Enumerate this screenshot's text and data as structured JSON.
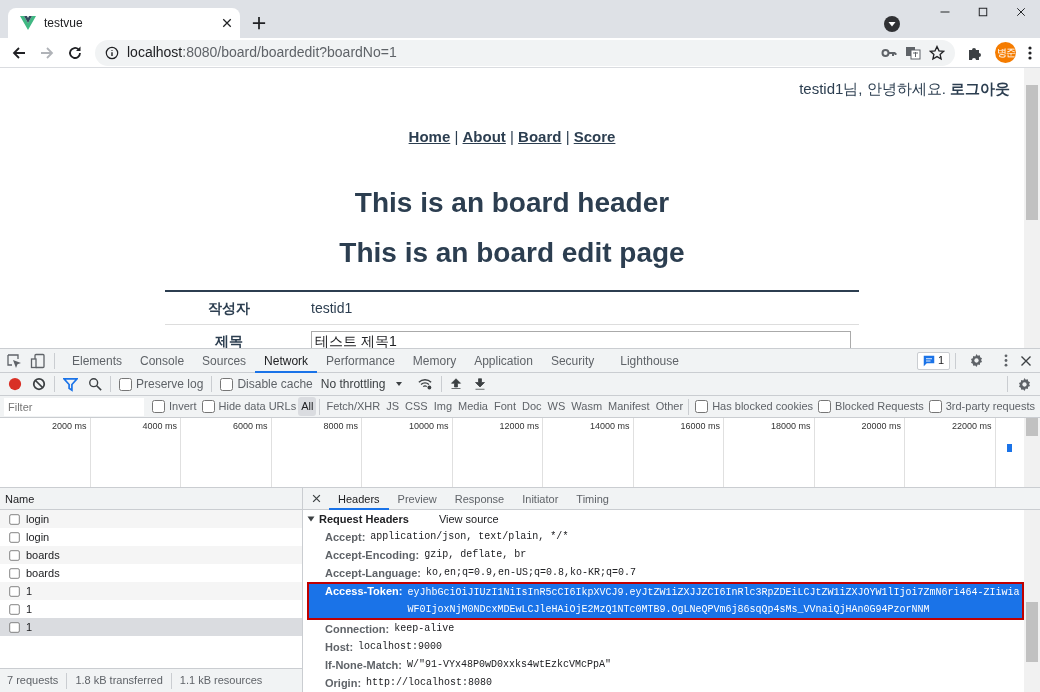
{
  "browser": {
    "tab_title": "testvue",
    "url": {
      "host": "localhost",
      "path": ":8080/board/boardedit?boardNo=1"
    },
    "avatar_text": "병준"
  },
  "page": {
    "greeting": "testid1님, 안녕하세요.",
    "logout": "로그아웃",
    "nav": [
      {
        "label": "Home"
      },
      {
        "label": "About"
      },
      {
        "label": "Board"
      },
      {
        "label": "Score"
      }
    ],
    "nav_separators": [
      "|",
      "|",
      "|"
    ],
    "headings": [
      "This is an board header",
      "This is an board edit page"
    ],
    "form_rows": [
      {
        "kind": "text",
        "label": "작성자",
        "value": "testid1"
      },
      {
        "kind": "input",
        "label": "제목",
        "value": "테스트 제목1"
      }
    ]
  },
  "devtools": {
    "tabs": [
      {
        "label": "Elements",
        "selected": false
      },
      {
        "label": "Console",
        "selected": false
      },
      {
        "label": "Sources",
        "selected": false
      },
      {
        "label": "Network",
        "selected": true
      },
      {
        "label": "Performance",
        "selected": false
      },
      {
        "label": "Memory",
        "selected": false
      },
      {
        "label": "Application",
        "selected": false
      },
      {
        "label": "Security",
        "selected": false
      },
      {
        "label": "Lighthouse",
        "selected": false
      }
    ],
    "issues_count": "1",
    "toolbar": {
      "checkboxes": [
        {
          "label": "Preserve log",
          "checked": false
        },
        {
          "label": "Disable cache",
          "checked": false
        }
      ],
      "throttling": "No throttling"
    },
    "filter": {
      "placeholder": "Filter",
      "left_checkboxes": [
        {
          "label": "Invert",
          "checked": false
        },
        {
          "label": "Hide data URLs",
          "checked": false
        }
      ],
      "types": [
        {
          "label": "All",
          "selected": true
        },
        {
          "label": "Fetch/XHR",
          "selected": false
        },
        {
          "label": "JS",
          "selected": false
        },
        {
          "label": "CSS",
          "selected": false
        },
        {
          "label": "Img",
          "selected": false
        },
        {
          "label": "Media",
          "selected": false
        },
        {
          "label": "Font",
          "selected": false
        },
        {
          "label": "Doc",
          "selected": false
        },
        {
          "label": "WS",
          "selected": false
        },
        {
          "label": "Wasm",
          "selected": false
        },
        {
          "label": "Manifest",
          "selected": false
        },
        {
          "label": "Other",
          "selected": false
        }
      ],
      "right_checkboxes": [
        {
          "label": "Has blocked cookies",
          "checked": false
        },
        {
          "label": "Blocked Requests",
          "checked": false
        },
        {
          "label": "3rd-party requests",
          "checked": false
        }
      ]
    },
    "timeline_ticks": [
      "2000 ms",
      "4000 ms",
      "6000 ms",
      "8000 ms",
      "10000 ms",
      "12000 ms",
      "14000 ms",
      "16000 ms",
      "18000 ms",
      "20000 ms",
      "22000 ms"
    ],
    "requests": {
      "column": "Name",
      "rows": [
        {
          "name": "login",
          "selected": false
        },
        {
          "name": "login",
          "selected": false
        },
        {
          "name": "boards",
          "selected": false
        },
        {
          "name": "boards",
          "selected": false
        },
        {
          "name": "1",
          "selected": false
        },
        {
          "name": "1",
          "selected": false
        },
        {
          "name": "1",
          "selected": true
        }
      ],
      "summary": [
        "7 requests",
        "1.8 kB transferred",
        "1.1 kB resources"
      ]
    },
    "detail_tabs": [
      {
        "label": "Headers",
        "selected": true
      },
      {
        "label": "Preview",
        "selected": false
      },
      {
        "label": "Response",
        "selected": false
      },
      {
        "label": "Initiator",
        "selected": false
      },
      {
        "label": "Timing",
        "selected": false
      }
    ],
    "section": {
      "title": "Request Headers",
      "expanded": true,
      "view_source": "View source"
    },
    "headers": [
      {
        "name": "Accept:",
        "value": "application/json, text/plain, */*",
        "selected": false
      },
      {
        "name": "Accept-Encoding:",
        "value": "gzip, deflate, br",
        "selected": false
      },
      {
        "name": "Accept-Language:",
        "value": "ko,en;q=0.9,en-US;q=0.8,ko-KR;q=0.7",
        "selected": false
      },
      {
        "name": "Access-Token:",
        "value": "eyJhbGciOiJIUzI1NiIsInR5cCI6IkpXVCJ9.eyJtZW1iZXJJZCI6InRlc3RpZDEiLCJtZW1iZXJOYW1lIjoi7ZmN6ri464-ZIiwiaWF0IjoxNjM0NDcxMDEwLCJleHAiOjE2MzQ1NTc0MTB9.OgLNeQPVm6j86sqQp4sMs_VVnaiQjHAn0G94PzorNNM",
        "selected": true
      },
      {
        "name": "Connection:",
        "value": "keep-alive",
        "selected": false
      },
      {
        "name": "Host:",
        "value": "localhost:9000",
        "selected": false
      },
      {
        "name": "If-None-Match:",
        "value": "W/\"91-VYx48P0wD0xxks4wtEzkcVMcPpA\"",
        "selected": false
      },
      {
        "name": "Origin:",
        "value": "http://localhost:8080",
        "selected": false
      }
    ]
  }
}
